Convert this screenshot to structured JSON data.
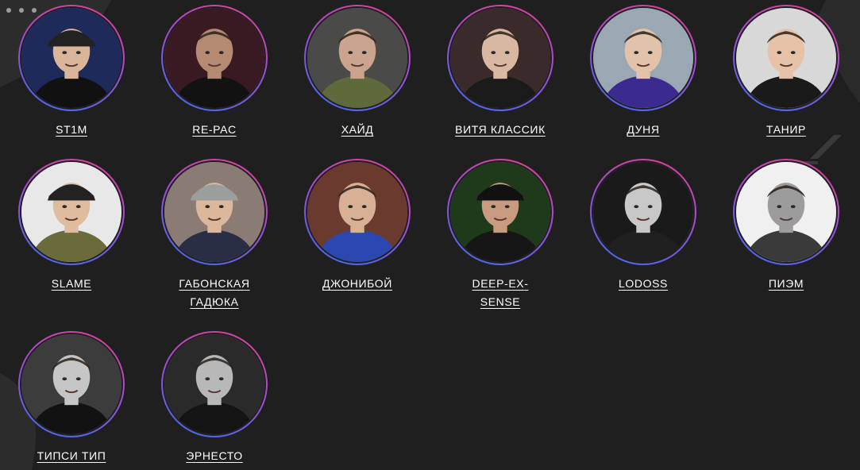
{
  "colors": {
    "background": "#1f1f20",
    "ring_start": "#e0418f",
    "ring_mid": "#a64bd3",
    "ring_end": "#3b6ef0",
    "text": "#ffffff"
  },
  "people": [
    {
      "name": "ST1M",
      "bg": "#1e2a5a",
      "skin": "#d9b59a",
      "shirt": "#111111",
      "hat": "#222222"
    },
    {
      "name": "RE-PAC",
      "bg": "#3a1a22",
      "skin": "#b48a72",
      "shirt": "#121212",
      "hat": ""
    },
    {
      "name": "ХАЙД",
      "bg": "#4a4a48",
      "skin": "#caa48c",
      "shirt": "#5e6a3c",
      "hat": ""
    },
    {
      "name": "ВИТЯ КЛАССИК",
      "bg": "#3b2a2a",
      "skin": "#d8b8a2",
      "shirt": "#1b1b1b",
      "hat": ""
    },
    {
      "name": "ДУНЯ",
      "bg": "#9aa8b4",
      "skin": "#e2c2a8",
      "shirt": "#3b2a8f",
      "hat": ""
    },
    {
      "name": "ТАНИР",
      "bg": "#d8d8d8",
      "skin": "#e6c3a8",
      "shirt": "#1a1a1a",
      "hat": ""
    },
    {
      "name": "SLAME",
      "bg": "#e8e8e8",
      "skin": "#e0bc9e",
      "shirt": "#6a6a3a",
      "hat": "#222222"
    },
    {
      "name": "ГАБОНСКАЯ ГАДЮКА",
      "bg": "#8a7c74",
      "skin": "#dcb79c",
      "shirt": "#2a2e44",
      "hat": "#9a9e9c"
    },
    {
      "name": "ДЖОНИБОЙ",
      "bg": "#6b3a2e",
      "skin": "#d8b096",
      "shirt": "#2a48b0",
      "hat": ""
    },
    {
      "name": "DEEP-EX-SENSE",
      "bg": "#1f3a1a",
      "skin": "#c89a80",
      "shirt": "#161616",
      "hat": "#111111"
    },
    {
      "name": "LODOSS",
      "bg": "#1a1a1a",
      "skin": "#c8c8c8",
      "shirt": "#202020",
      "hat": ""
    },
    {
      "name": "ПИЭМ",
      "bg": "#f0f0f0",
      "skin": "#9c9c9c",
      "shirt": "#3a3a3a",
      "hat": ""
    },
    {
      "name": "ТИПСИ ТИП",
      "bg": "#3c3c3c",
      "skin": "#c6c6c6",
      "shirt": "#121212",
      "hat": ""
    },
    {
      "name": "ЭРНЕСТО",
      "bg": "#2a2a2a",
      "skin": "#b8b8b8",
      "shirt": "#141414",
      "hat": ""
    }
  ]
}
